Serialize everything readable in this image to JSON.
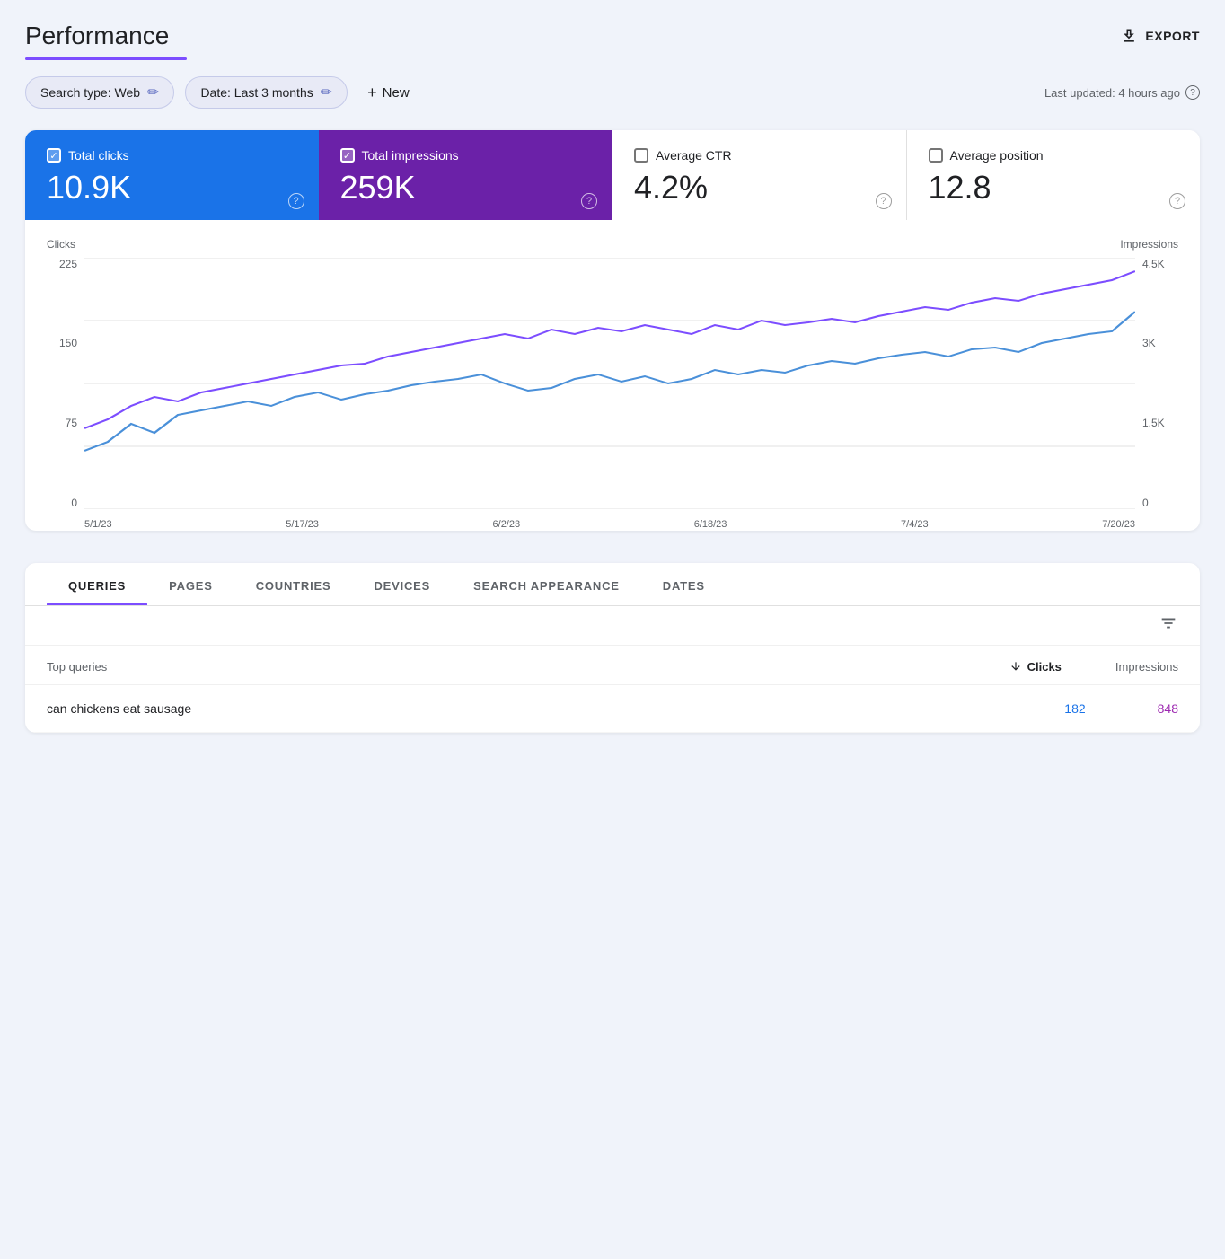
{
  "page": {
    "title": "Performance",
    "export_label": "EXPORT",
    "last_updated": "Last updated: 4 hours ago"
  },
  "filters": {
    "search_type_label": "Search type: Web",
    "date_label": "Date: Last 3 months",
    "new_label": "New"
  },
  "metrics": [
    {
      "id": "total-clicks",
      "label": "Total clicks",
      "value": "10.9K",
      "active": "blue"
    },
    {
      "id": "total-impressions",
      "label": "Total impressions",
      "value": "259K",
      "active": "purple"
    },
    {
      "id": "average-ctr",
      "label": "Average CTR",
      "value": "4.2%",
      "active": "none"
    },
    {
      "id": "average-position",
      "label": "Average position",
      "value": "12.8",
      "active": "none"
    }
  ],
  "chart": {
    "left_axis_title": "Clicks",
    "right_axis_title": "Impressions",
    "left_labels": [
      "225",
      "150",
      "75",
      "0"
    ],
    "right_labels": [
      "4.5K",
      "3K",
      "1.5K",
      "0"
    ],
    "x_labels": [
      "5/1/23",
      "5/17/23",
      "6/2/23",
      "6/18/23",
      "7/4/23",
      "7/20/23"
    ]
  },
  "tabs": {
    "items": [
      {
        "id": "queries",
        "label": "QUERIES",
        "active": true
      },
      {
        "id": "pages",
        "label": "PAGES",
        "active": false
      },
      {
        "id": "countries",
        "label": "COUNTRIES",
        "active": false
      },
      {
        "id": "devices",
        "label": "DEVICES",
        "active": false
      },
      {
        "id": "search-appearance",
        "label": "SEARCH APPEARANCE",
        "active": false
      },
      {
        "id": "dates",
        "label": "DATES",
        "active": false
      }
    ]
  },
  "table": {
    "col_query_label": "Top queries",
    "col_clicks_label": "Clicks",
    "col_impressions_label": "Impressions",
    "rows": [
      {
        "query": "can chickens eat sausage",
        "clicks": "182",
        "impressions": "848"
      }
    ]
  }
}
